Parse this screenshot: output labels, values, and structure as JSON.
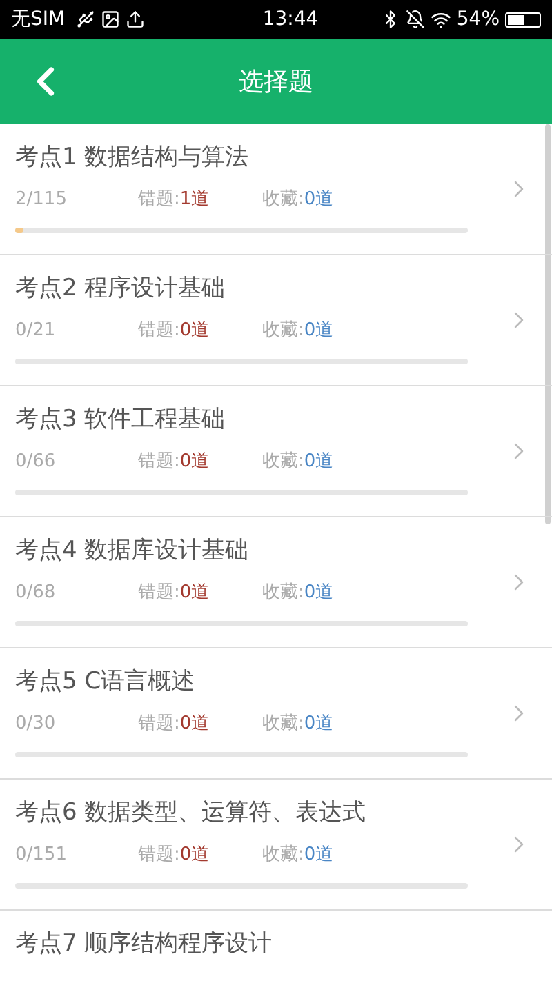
{
  "status_bar": {
    "carrier": "无SIM",
    "time": "13:44",
    "battery": "54%"
  },
  "header": {
    "title": "选择题"
  },
  "items": [
    {
      "title": "考点1 数据结构与算法",
      "progress": "2/115",
      "wrong_label": "错题:",
      "wrong": "1道",
      "fav_label": "收藏:",
      "fav": "0道",
      "level": 0.017
    },
    {
      "title": "考点2 程序设计基础",
      "progress": "0/21",
      "wrong_label": "错题:",
      "wrong": "0道",
      "fav_label": "收藏:",
      "fav": "0道",
      "level": 0
    },
    {
      "title": "考点3 软件工程基础",
      "progress": "0/66",
      "wrong_label": "错题:",
      "wrong": "0道",
      "fav_label": "收藏:",
      "fav": "0道",
      "level": 0
    },
    {
      "title": "考点4 数据库设计基础",
      "progress": "0/68",
      "wrong_label": "错题:",
      "wrong": "0道",
      "fav_label": "收藏:",
      "fav": "0道",
      "level": 0
    },
    {
      "title": "考点5 C语言概述",
      "progress": "0/30",
      "wrong_label": "错题:",
      "wrong": "0道",
      "fav_label": "收藏:",
      "fav": "0道",
      "level": 0
    },
    {
      "title": "考点6 数据类型、运算符、表达式",
      "progress": "0/151",
      "wrong_label": "错题:",
      "wrong": "0道",
      "fav_label": "收藏:",
      "fav": "0道",
      "level": 0
    },
    {
      "title": "考点7 顺序结构程序设计"
    }
  ]
}
